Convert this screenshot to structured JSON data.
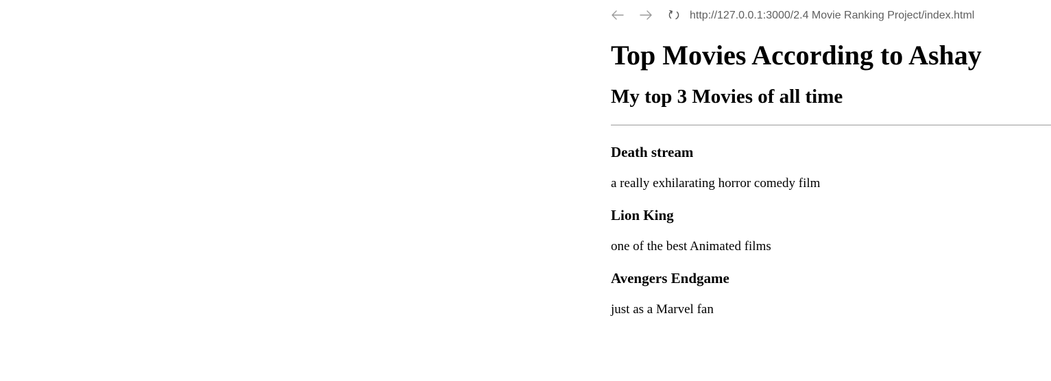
{
  "browser": {
    "back_icon": "arrow-left-icon",
    "forward_icon": "arrow-right-icon",
    "reload_icon": "reload-icon",
    "url": "http://127.0.0.1:3000/2.4 Movie Ranking Project/index.html"
  },
  "page": {
    "title": "Top Movies According to Ashay",
    "subtitle": "My top 3 Movies of all time",
    "movies": [
      {
        "title": "Death stream",
        "description": "a really exhilarating horror comedy film"
      },
      {
        "title": "Lion King",
        "description": "one of the best Animated films"
      },
      {
        "title": "Avengers Endgame",
        "description": "just as a Marvel fan"
      }
    ]
  }
}
